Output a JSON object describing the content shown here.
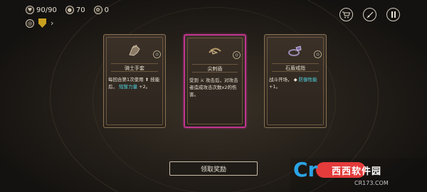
{
  "hud": {
    "health": "90/90",
    "gold": "70",
    "resource": "0"
  },
  "buttons": {
    "claim_reward": "领取奖励"
  },
  "cards": [
    {
      "title": "骑士手套",
      "desc_pre": "每回合第1次使用",
      "desc_mid": "技能后，",
      "desc_hl": "短暂力量",
      "desc_post": "+2。",
      "selected": false
    },
    {
      "title": "尖刺盾",
      "desc_pre": "受到",
      "desc_mid": "攻击后，对攻击者造成攻击次数x2的伤害。",
      "desc_hl": "",
      "desc_post": "",
      "selected": true
    },
    {
      "title": "石盾戒指",
      "desc_pre": "战斗开场，",
      "desc_mid": "",
      "desc_hl": "防御性能",
      "desc_post": "+1。",
      "selected": false
    }
  ],
  "watermark": {
    "brand": "西西软件园",
    "url": "CR173.COM",
    "logo": "Cr"
  },
  "colors": {
    "selected_border": "#c0358f",
    "highlight_text": "#4fd3e0",
    "card_border": "#8a7252"
  }
}
